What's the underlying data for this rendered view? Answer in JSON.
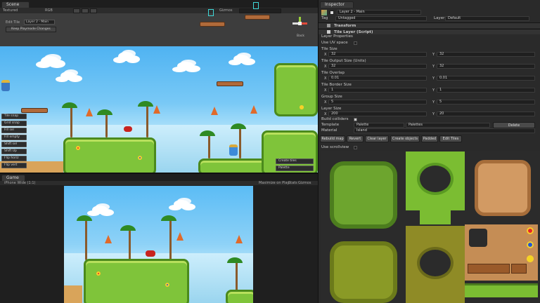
{
  "scene_panel": {
    "tab": "Scene",
    "textured": "Textured",
    "rgb": "RGB",
    "gizmos": "Gizmos",
    "search": "All",
    "edit_tile_label": "Edit Tile",
    "layer_dropdown": "Layer 2 - Main",
    "keep_changes_btn": "Keep Playmode Changes",
    "back_label": "Back",
    "side_buttons": [
      "Tile snap",
      "Grid snap",
      "Fill sel",
      "Fill empty",
      "Shift sel",
      "Shift Up",
      "Flip horiz",
      "Flip vert"
    ],
    "bottom_buttons": [
      "Create tiles",
      "Palette"
    ]
  },
  "game_panel": {
    "tab": "Game",
    "resolution": "iPhone Wide (1:1)",
    "maximize_on_play": "Maximize on Play",
    "stats": "Stats",
    "gizmos": "Gizmos"
  },
  "inspector": {
    "tab": "Inspector",
    "object_name": "Layer 2 - Main",
    "tag_label": "Tag",
    "tag_value": "Untagged",
    "layer_label": "Layer",
    "layer_value": "Default",
    "transform_label": "Transform",
    "tile_layer_label": "Tile Layer (Script)",
    "layer_properties": "Layer Properties",
    "use_uv_space": "Use UV space",
    "tile_size_label": "Tile Size",
    "tile_size": {
      "x": "32",
      "y": "32"
    },
    "tile_output_size_label": "Tile Output Size (Units)",
    "tile_output_size": {
      "x": "32",
      "y": "32"
    },
    "tile_overlap_label": "Tile Overlap",
    "tile_overlap": {
      "x": "0.01",
      "y": "0.01"
    },
    "tile_border_size_label": "Tile Border Size",
    "tile_border_size": {
      "x": "1",
      "y": "1"
    },
    "group_size_label": "Group Size",
    "group_size": {
      "x": "5",
      "y": "5"
    },
    "layer_size_label": "Layer Size",
    "layer_size": {
      "x": "200",
      "y": "20"
    },
    "build_colliders": "Build colliders",
    "template_label": "Template",
    "template_value": "Palette",
    "palette_field": "Palettes",
    "delete_btn": "Delete",
    "material_label": "Material",
    "material_value": "Island",
    "action_buttons": [
      "Rebuild map",
      "Revert",
      "Clear layer",
      "Create objects",
      "Padded",
      "Edit Tiles"
    ],
    "use_scrollview": "Use scrollview",
    "axis_x": "X",
    "axis_y": "Y"
  }
}
